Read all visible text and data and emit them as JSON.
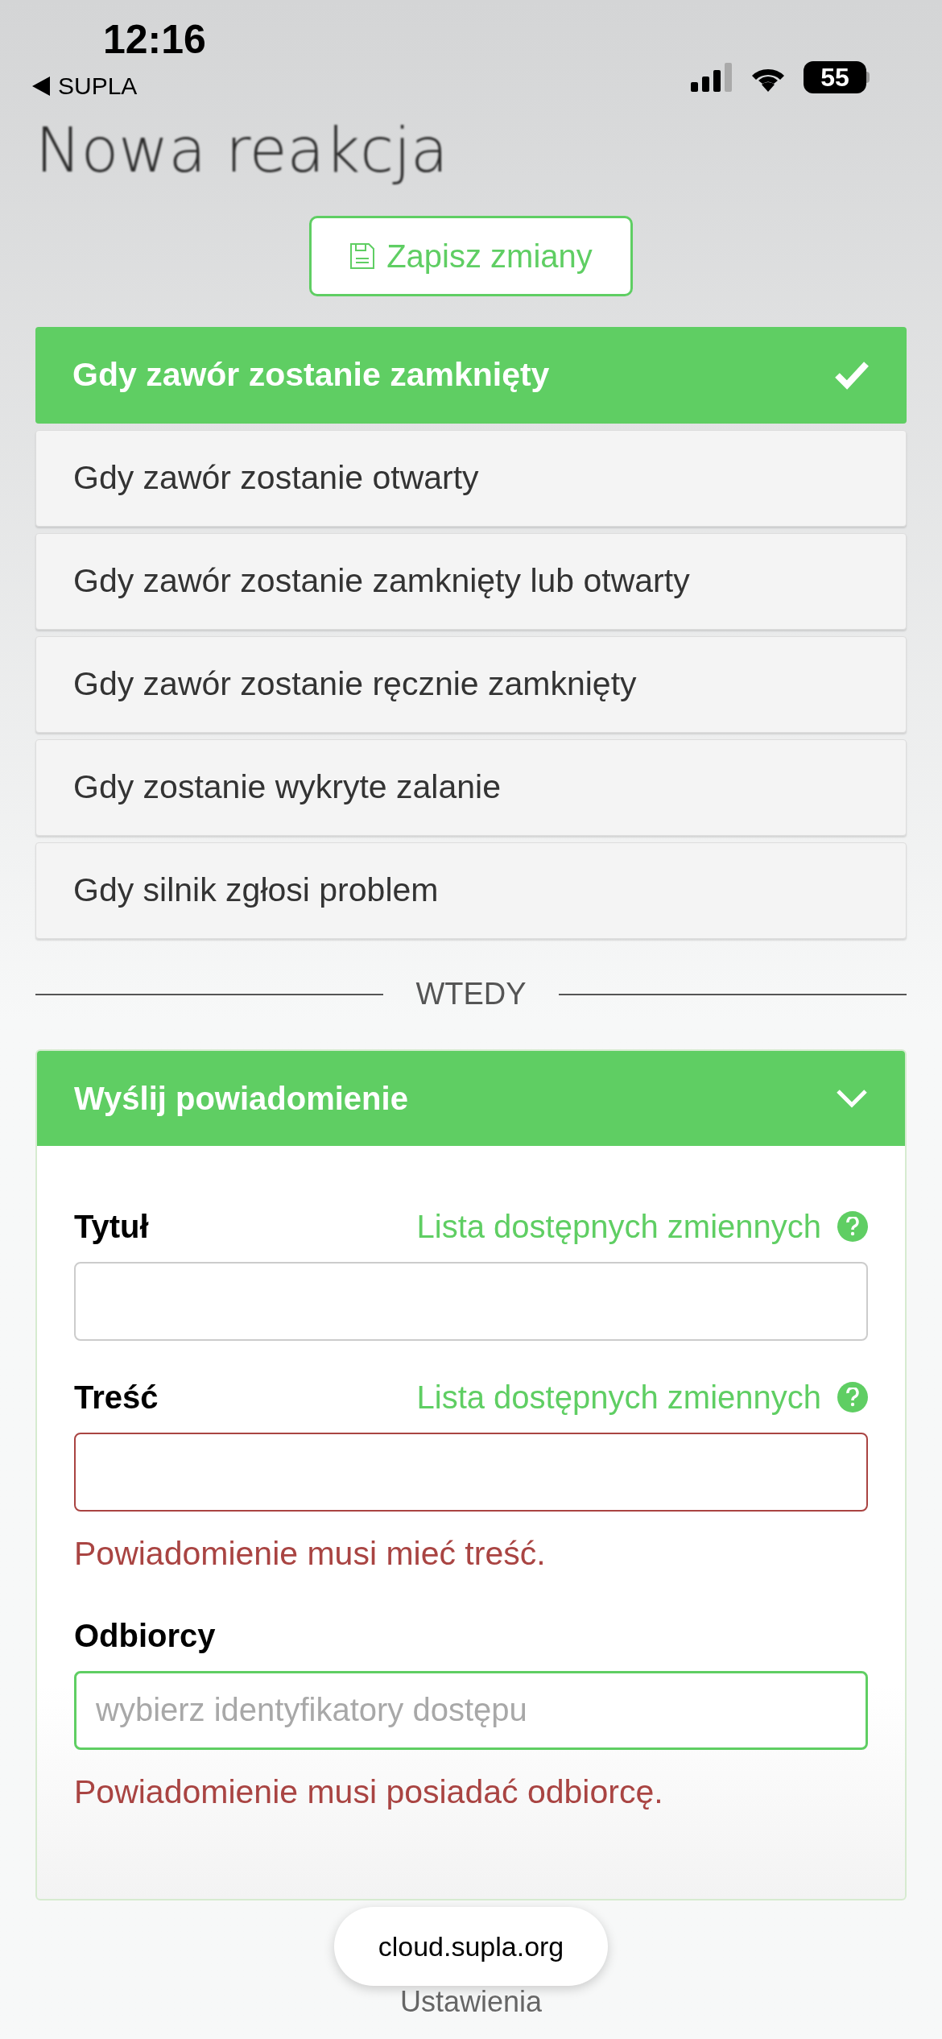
{
  "status_bar": {
    "time": "12:16",
    "back_label": "SUPLA",
    "battery": "55"
  },
  "page": {
    "title": "Nowa reakcja",
    "save_button": "Zapisz zmiany"
  },
  "triggers": [
    {
      "label": "Gdy zawór zostanie zamknięty",
      "selected": true
    },
    {
      "label": "Gdy zawór zostanie otwarty",
      "selected": false
    },
    {
      "label": "Gdy zawór zostanie zamknięty lub otwarty",
      "selected": false
    },
    {
      "label": "Gdy zawór zostanie ręcznie zamknięty",
      "selected": false
    },
    {
      "label": "Gdy zostanie wykryte zalanie",
      "selected": false
    },
    {
      "label": "Gdy silnik zgłosi problem",
      "selected": false
    }
  ],
  "divider": "WTEDY",
  "action": {
    "title": "Wyślij powiadomienie",
    "expanded": true,
    "fields": [
      {
        "label": "Tytuł",
        "help_link": "Lista dostępnych zmiennych",
        "invalid": false,
        "focused": false
      },
      {
        "label": "Treść",
        "help_link": "Lista dostępnych zmiennych",
        "invalid": true,
        "focused": false,
        "error": "Powiadomienie musi mieć treść."
      },
      {
        "label": "Odbiorcy",
        "placeholder": "wybierz identyfikatory dostępu",
        "focused": true,
        "error": "Powiadomienie musi posiadać odbiorcę."
      }
    ]
  },
  "next_section": "Ustawienia",
  "url_bar": "cloud.supla.org"
}
